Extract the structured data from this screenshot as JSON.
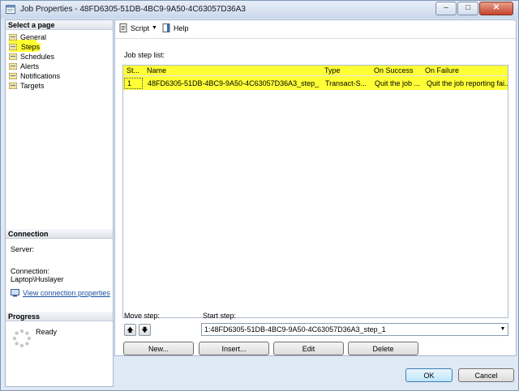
{
  "window": {
    "title": "Job Properties - 48FD6305-51DB-4BC9-9A50-4C63057D36A3",
    "controls": [
      "minimize",
      "maximize",
      "close"
    ]
  },
  "left": {
    "select_page_header": "Select a page",
    "pages": [
      "General",
      "Steps",
      "Schedules",
      "Alerts",
      "Notifications",
      "Targets"
    ],
    "selected_page": "Steps",
    "connection_header": "Connection",
    "server_label": "Server:",
    "server_value": "",
    "connection_label": "Connection:",
    "connection_value": "Laptop\\Huslayer",
    "view_connection_link": "View connection properties",
    "progress_header": "Progress",
    "progress_status": "Ready"
  },
  "toolbar": {
    "script_label": "Script",
    "help_label": "Help"
  },
  "main": {
    "list_label": "Job step list:",
    "columns": [
      "St...",
      "Name",
      "Type",
      "On Success",
      "On Failure"
    ],
    "rows": [
      {
        "step": "1",
        "name": "48FD6305-51DB-4BC9-9A50-4C63057D36A3_step_1",
        "type": "Transact-S...",
        "on_success": "Quit the job ...",
        "on_failure": "Quit the job reporting fai..."
      }
    ],
    "move_step_label": "Move step:",
    "start_step_label": "Start step:",
    "start_step_value": "1:48FD6305-51DB-4BC9-9A50-4C63057D36A3_step_1",
    "buttons": {
      "new": "New...",
      "insert": "Insert...",
      "edit": "Edit",
      "delete": "Delete"
    }
  },
  "footer": {
    "ok": "OK",
    "cancel": "Cancel"
  },
  "colors": {
    "highlight": "#ffff36",
    "link": "#1a4fa0"
  }
}
